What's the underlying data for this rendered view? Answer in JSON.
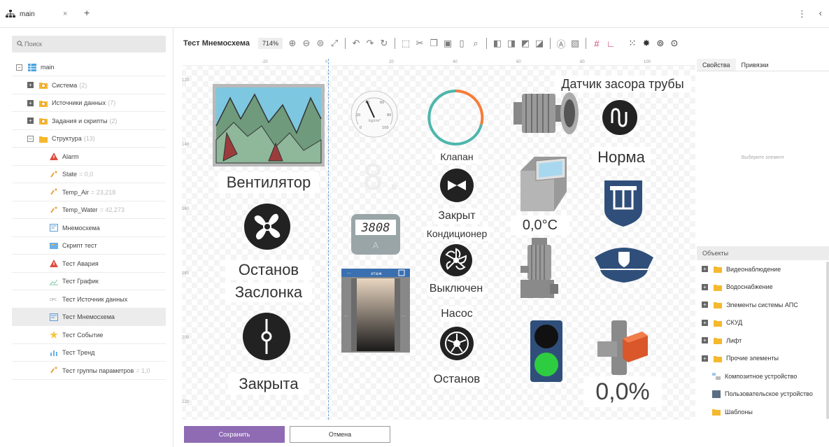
{
  "tab": {
    "label": "main",
    "close": "×",
    "add": "+"
  },
  "top": {
    "menu": "⋮",
    "collapse": "‹"
  },
  "search": {
    "placeholder": "Поиск"
  },
  "tree": {
    "root": "main",
    "items": [
      {
        "label": "Система",
        "count": "(2)",
        "icon": "folder-badge-icon"
      },
      {
        "label": "Источники данных",
        "count": "(7)",
        "icon": "folder-badge-icon"
      },
      {
        "label": "Задания и скрипты",
        "count": "(2)",
        "icon": "folder-badge-icon"
      },
      {
        "label": "Структура",
        "count": "(13)",
        "icon": "folder-icon"
      },
      {
        "label": "Alarm",
        "count": "",
        "icon": "alarm-icon"
      },
      {
        "label": "State",
        "count": "= 0,0",
        "icon": "param-icon"
      },
      {
        "label": "Temp_Air",
        "count": "= 23,218",
        "icon": "param-icon"
      },
      {
        "label": "Temp_Water",
        "count": "= 42,273",
        "icon": "param-icon"
      },
      {
        "label": "Мнемосхема",
        "count": "",
        "icon": "mnemo-icon"
      },
      {
        "label": "Скрипт тест",
        "count": "",
        "icon": "script-icon"
      },
      {
        "label": "Тест Авария",
        "count": "",
        "icon": "alarm-icon"
      },
      {
        "label": "Тест График",
        "count": "",
        "icon": "chart-icon"
      },
      {
        "label": "Тест Источник данных",
        "count": "",
        "icon": "opc-icon",
        "prefix": "OPC"
      },
      {
        "label": "Тест Мнемосхема",
        "count": "",
        "icon": "mnemo-icon"
      },
      {
        "label": "Тест Событие",
        "count": "",
        "icon": "event-icon"
      },
      {
        "label": "Тест Тренд",
        "count": "",
        "icon": "trend-icon"
      },
      {
        "label": "Тест группы параметров",
        "count": "= 1,0",
        "icon": "param-icon"
      }
    ]
  },
  "toolbar": {
    "title": "Тест Мнемосхема",
    "zoom": "714%"
  },
  "props": {
    "tab1": "Свойства",
    "tab2": "Привязки",
    "empty": "Выберите элемент"
  },
  "objects": {
    "header": "Объекты",
    "items": [
      {
        "label": "Видеонаблюдение",
        "sub": false
      },
      {
        "label": "Водоснабжение",
        "sub": false
      },
      {
        "label": "Элементы системы АПС",
        "sub": false
      },
      {
        "label": "СКУД",
        "sub": false
      },
      {
        "label": "Лифт",
        "sub": false
      },
      {
        "label": "Прочие элементы",
        "sub": false
      },
      {
        "label": "Композитное устройство",
        "sub": true
      },
      {
        "label": "Пользовательское устройство",
        "sub": true
      },
      {
        "label": "Шаблоны",
        "sub": true
      }
    ]
  },
  "ruler": {
    "top": [
      "-20",
      "0",
      "20",
      "40",
      "60",
      "80",
      "100"
    ],
    "left": [
      "120",
      "140",
      "160",
      "180",
      "200",
      "220"
    ]
  },
  "canvas": {
    "ventilator": "Вентилятор",
    "ostanov1": "Останов",
    "zaslonka": "Заслонка",
    "zakryta": "Закрыта",
    "klapan": "Клапан",
    "zakryt": "Закрыт",
    "konditsioner": "Кондиционер",
    "vyklyuchen": "Выключен",
    "nasos": "Насос",
    "ostanov2": "Останов",
    "sensor_title": "Датчик засора трубы",
    "norma": "Норма",
    "temp": "0,0°C",
    "percent": "0,0%",
    "meter": "3808",
    "meter_unit": "A",
    "gauge_unit": "kg/cm²",
    "gauge_ticks": [
      "0",
      "20",
      "40",
      "60",
      "80",
      "100"
    ],
    "lift_label": "этаж",
    "lift_dots": "···"
  },
  "buttons": {
    "save": "Сохранить",
    "cancel": "Отмена"
  },
  "colors": {
    "accent": "#8e6bb3",
    "arc_teal": "#4db6ac",
    "arc_orange": "#f57c3a",
    "navy": "#2f4f7a",
    "green": "#2ecc40"
  }
}
